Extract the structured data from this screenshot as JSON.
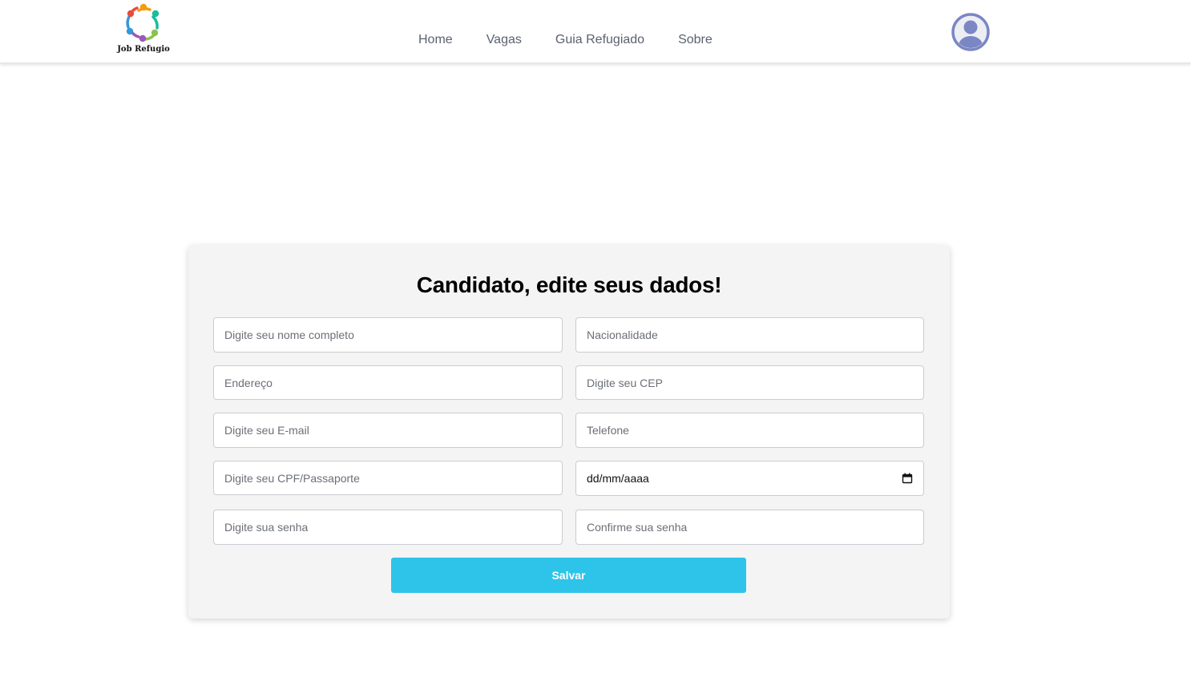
{
  "brand": {
    "name": "Job Refugio"
  },
  "nav": {
    "links": [
      {
        "label": "Home"
      },
      {
        "label": "Vagas"
      },
      {
        "label": "Guia Refugiado"
      },
      {
        "label": "Sobre"
      }
    ]
  },
  "form": {
    "title": "Candidato, edite seus dados!",
    "fields": {
      "nome": {
        "placeholder": "Digite seu nome completo",
        "value": ""
      },
      "nacionalidade": {
        "placeholder": "Nacionalidade",
        "value": ""
      },
      "endereco": {
        "placeholder": "Endereço",
        "value": ""
      },
      "cep": {
        "placeholder": "Digite seu CEP",
        "value": ""
      },
      "email": {
        "placeholder": "Digite seu E-mail",
        "value": ""
      },
      "telefone": {
        "placeholder": "Telefone",
        "value": ""
      },
      "documento": {
        "placeholder": "Digite seu CPF/Passaporte",
        "value": ""
      },
      "nascimento": {
        "value": "dd/mm/aaaa"
      },
      "senha": {
        "placeholder": "Digite sua senha",
        "value": ""
      },
      "confirma_senha": {
        "placeholder": "Confirme sua senha",
        "value": ""
      }
    },
    "save_label": "Salvar"
  },
  "colors": {
    "accent": "#2ec4ea",
    "card_bg": "#f4f4f4",
    "avatar": "#7b86c4"
  }
}
